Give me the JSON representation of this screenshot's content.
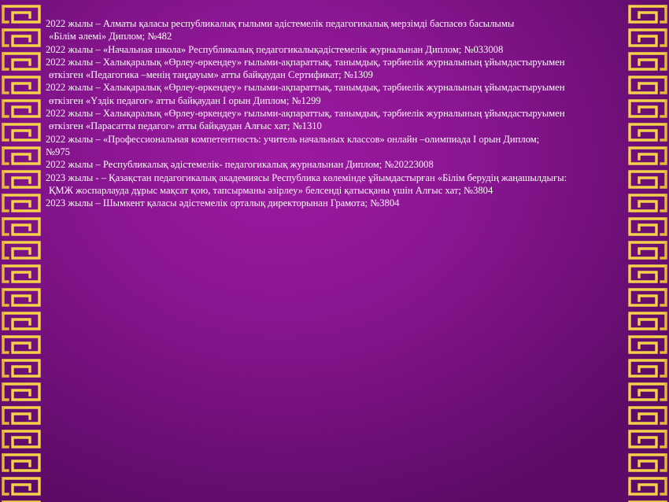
{
  "slide": {
    "lines": [
      "2022 жылы – Алматы қаласы республикалық ғылыми әдістемелік  педагогикалық мерзімді  баспасөз басылымы",
      " «Білім  әлемі»  Диплом; №482",
      "2022 жылы – «Начальная  школа»  Республикалық педагогикалықәдістемелік  журналынан Диплом; №033008",
      "2022 жылы – Халықаралық «Өрлеу-өркендеу» ғылыми-ақпараттық, танымдық, тәрбиелік журналының ұйымдастыруымен",
      " өткізген  «Педагогика –менің таңдауым» атты байқаудан Сертификат; №1309",
      "2022 жылы – Халықаралық «Өрлеу-өркендеу» ғылыми-ақпараттық, танымдық, тәрбиелік журналының ұйымдастыруымен",
      " өткізген «Үздік  педагог» атты байқаудан І орын Диплом; №1299",
      "2022 жылы – Халықаралық «Өрлеу-өркендеу» ғылыми-ақпараттық, танымдық, тәрбиелік журналының ұйымдастыруымен",
      " өткізген  «Парасатты педагог» атты байқаудан  Алғыс хат; №1310",
      "2022 жылы – «Профессиональная  компетентность: учитель начальных классов» онлайн –олимпиада І орын Диплом;",
      "№975",
      "2022 жылы – Республикалық әдістемелік-  педагогикалық журналынан Диплом; №20223008",
      "2023 жылы - – Қазақстан педагогикалық академиясы Республика көлемінде ұйымдастырған «Білім  берудің жаңашылдығы:",
      " ҚМЖ жоспарлауда дұрыс мақсат қою, тапсырманы әзірлеу»  белсенді қатысқаны үшін  Алғыс хат; №3804",
      "2023 жылы – Шымкент қаласы әдістемелік  орталық директорынан Грамота;  №3804"
    ]
  },
  "colors": {
    "background": "#8a1691",
    "ornament": "#f5d04a",
    "text": "#ffffff"
  }
}
